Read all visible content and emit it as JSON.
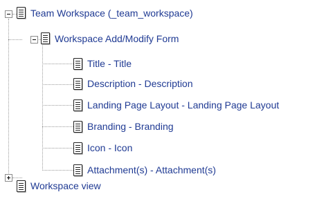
{
  "tree": {
    "root": {
      "label": "Team Workspace (_team_workspace)",
      "icon": "document-icon",
      "expanded": true
    },
    "form": {
      "label": "Workspace Add/Modify Form",
      "icon": "document-icon",
      "expanded": true,
      "fields": [
        {
          "label": "Title - Title",
          "icon": "document-icon"
        },
        {
          "label": "Description - Description",
          "icon": "document-icon"
        },
        {
          "label": "Landing Page Layout - Landing Page Layout",
          "icon": "document-icon"
        },
        {
          "label": "Branding - Branding",
          "icon": "document-icon"
        },
        {
          "label": "Icon - Icon",
          "icon": "document-icon"
        },
        {
          "label": "Attachment(s) - Attachment(s)",
          "icon": "document-icon"
        }
      ]
    },
    "view": {
      "label": "Workspace view",
      "icon": "document-icon",
      "expanded": false
    }
  },
  "colors": {
    "link": "#1f3a93",
    "connector": "#9a9a9a"
  }
}
